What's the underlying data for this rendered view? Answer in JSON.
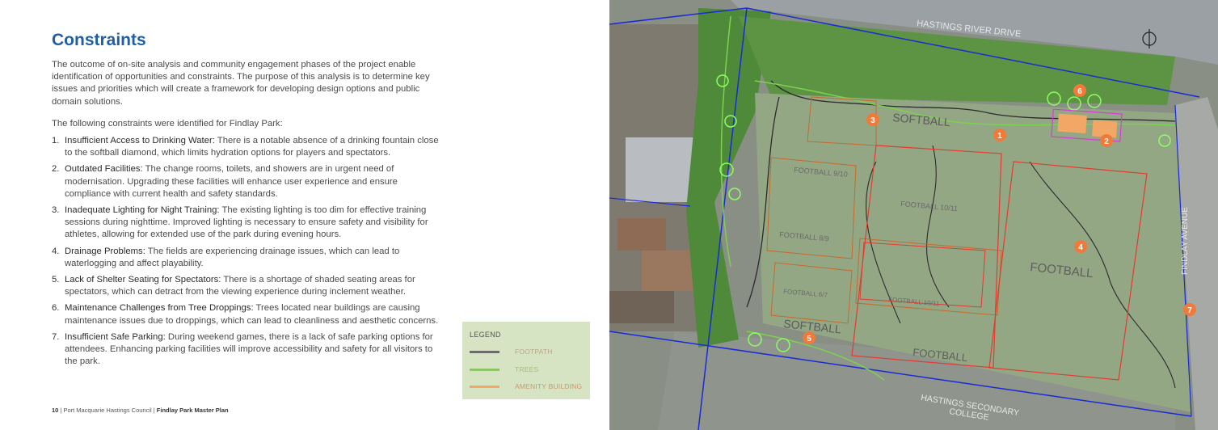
{
  "page": {
    "title": "Constraints",
    "intro": "The outcome of on-site analysis and community engagement phases of the project enable identification of opportunities and constraints. The purpose of this analysis is to determine key issues and priorities which will create a framework for developing design options and public domain solutions.",
    "lead": "The following constraints were identified for Findlay Park:",
    "constraints": [
      {
        "num": "1.",
        "head": "Insufficient Access to Drinking Water:",
        "body": " There is a notable absence of a drinking fountain close to the softball diamond, which limits hydration options for players and spectators."
      },
      {
        "num": "2.",
        "head": "Outdated Facilities:",
        "body": " The change rooms, toilets, and showers are in urgent need of modernisation. Upgrading these facilities will enhance user experience and ensure compliance with current health and safety standards."
      },
      {
        "num": "3.",
        "head": "Inadequate Lighting for Night Training:",
        "body": " The existing lighting is too dim for effective training sessions during nighttime. Improved lighting is necessary to ensure safety and visibility for athletes, allowing for extended use of the park during evening hours."
      },
      {
        "num": "4.",
        "head": "Drainage Problems:",
        "body": " The fields are experiencing drainage issues, which can lead to waterlogging and affect playability."
      },
      {
        "num": "5.",
        "head": "Lack of Shelter Seating for Spectators:",
        "body": " There is a shortage of shaded seating areas for spectators, which can detract from the viewing experience during inclement weather."
      },
      {
        "num": "6.",
        "head": "Maintenance Challenges from Tree Droppings:",
        "body": " Trees located near buildings are causing maintenance issues due to droppings, which can lead to cleanliness and aesthetic concerns."
      },
      {
        "num": "7.",
        "head": "Insufficient Safe Parking:",
        "body": " During weekend games, there is a lack of safe parking options for attendees. Enhancing parking facilities will improve accessibility and safety for all visitors to the park."
      }
    ],
    "footer": {
      "page_num": "10",
      "org": " | Port Macquarie Hastings Council | ",
      "doc": "Findlay Park Master Plan"
    }
  },
  "legend": {
    "title": "LEGEND",
    "items": [
      {
        "label": "FOOTPATH",
        "color": "#6b6b6b"
      },
      {
        "label": "TREES",
        "color": "#8cc466"
      },
      {
        "label": "AMENITY BUILDING",
        "color": "#f2a766"
      }
    ]
  },
  "map": {
    "labels": {
      "road_top": "HASTINGS RIVER DRIVE",
      "road_right": "FINDLAY AVENUE",
      "school": "HASTINGS SECONDARY COLLEGE",
      "school_line1": "HASTINGS SECONDARY",
      "school_line2": "COLLEGE",
      "softball_top": "SOFTBALL",
      "softball_bottom": "SOFTBALL",
      "football_1": "FOOTBALL 9/10",
      "football_2": "FOOTBALL 10/11",
      "football_3": "FOOTBALL 8/9",
      "football_4": "FOOTBALL",
      "football_5": "FOOTBALL 6/7",
      "football_6": "FOOTBALL 10/11",
      "football_7": "FOOTBALL"
    },
    "markers": [
      "1",
      "2",
      "3",
      "4",
      "5",
      "6",
      "7"
    ],
    "marker_color": "#f07a3a"
  }
}
